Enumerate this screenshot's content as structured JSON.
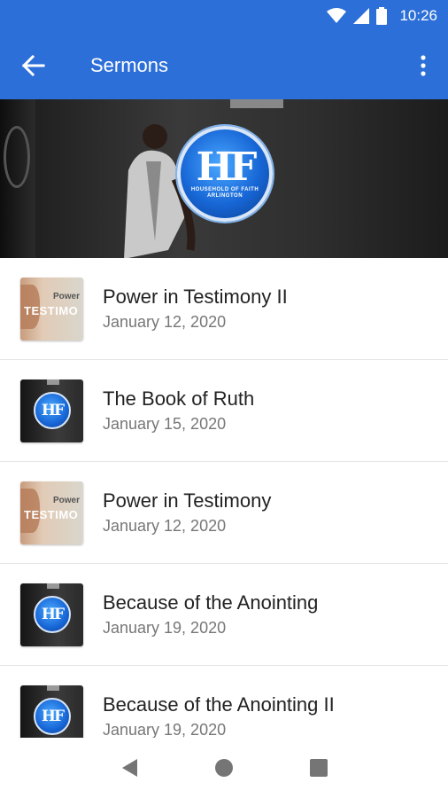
{
  "status_bar": {
    "time": "10:26",
    "icons": [
      "wifi-icon",
      "signal-icon",
      "battery-icon"
    ]
  },
  "app_bar": {
    "title": "Sermons",
    "back_icon": "arrow-back-icon",
    "menu_icon": "more-vert-icon",
    "background_color": "#2c6fd8"
  },
  "hero": {
    "logo_mark": "HF",
    "logo_text": "HOUSEHOLD OF FAITH ARLINGTON"
  },
  "sermons": [
    {
      "title": "Power in Testimony II",
      "date": "January 12, 2020",
      "thumb_power": "Power",
      "thumb_text": "TESTIMO"
    },
    {
      "title": "The Book of Ruth",
      "date": "January 15, 2020",
      "thumb_mark": "HF"
    },
    {
      "title": "Power in Testimony",
      "date": "January 12, 2020",
      "thumb_power": "Power",
      "thumb_text": "TESTIMO"
    },
    {
      "title": "Because of the Anointing",
      "date": "January 19, 2020",
      "thumb_mark": "HF"
    },
    {
      "title": "Because of the Anointing II",
      "date": "January 19, 2020",
      "thumb_mark": "HF"
    }
  ],
  "nav_bar": {
    "icons": [
      "back-triangle-icon",
      "home-circle-icon",
      "recents-square-icon"
    ]
  }
}
